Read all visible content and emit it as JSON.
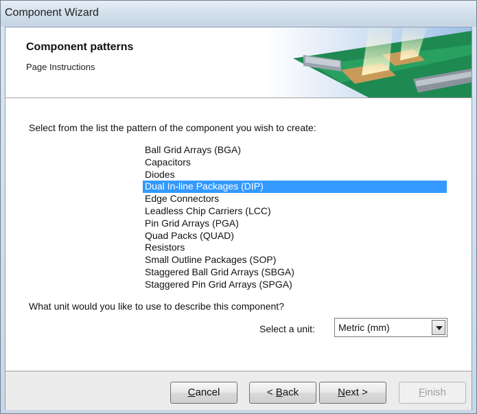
{
  "window": {
    "title": "Component Wizard"
  },
  "header": {
    "title": "Component patterns",
    "subtitle": "Page Instructions"
  },
  "prompt": "Select from the list the pattern of the component you wish to create:",
  "patterns": [
    "Ball Grid Arrays (BGA)",
    "Capacitors",
    "Diodes",
    "Dual In-line Packages (DIP)",
    "Edge Connectors",
    "Leadless Chip Carriers (LCC)",
    "Pin Grid Arrays (PGA)",
    "Quad Packs (QUAD)",
    "Resistors",
    "Small Outline Packages (SOP)",
    "Staggered Ball Grid Arrays (SBGA)",
    "Staggered Pin Grid Arrays (SPGA)"
  ],
  "selected_pattern": "Dual In-line Packages (DIP)",
  "unit": {
    "question": "What unit would you like to use to describe this component?",
    "label": "Select a unit:",
    "value": "Metric (mm)"
  },
  "buttons": {
    "cancel": "Cancel",
    "back": "< Back",
    "next": "Next >",
    "finish": "Finish"
  },
  "colors": {
    "selection": "#3399ff",
    "banner_board": "#1e8a52"
  }
}
